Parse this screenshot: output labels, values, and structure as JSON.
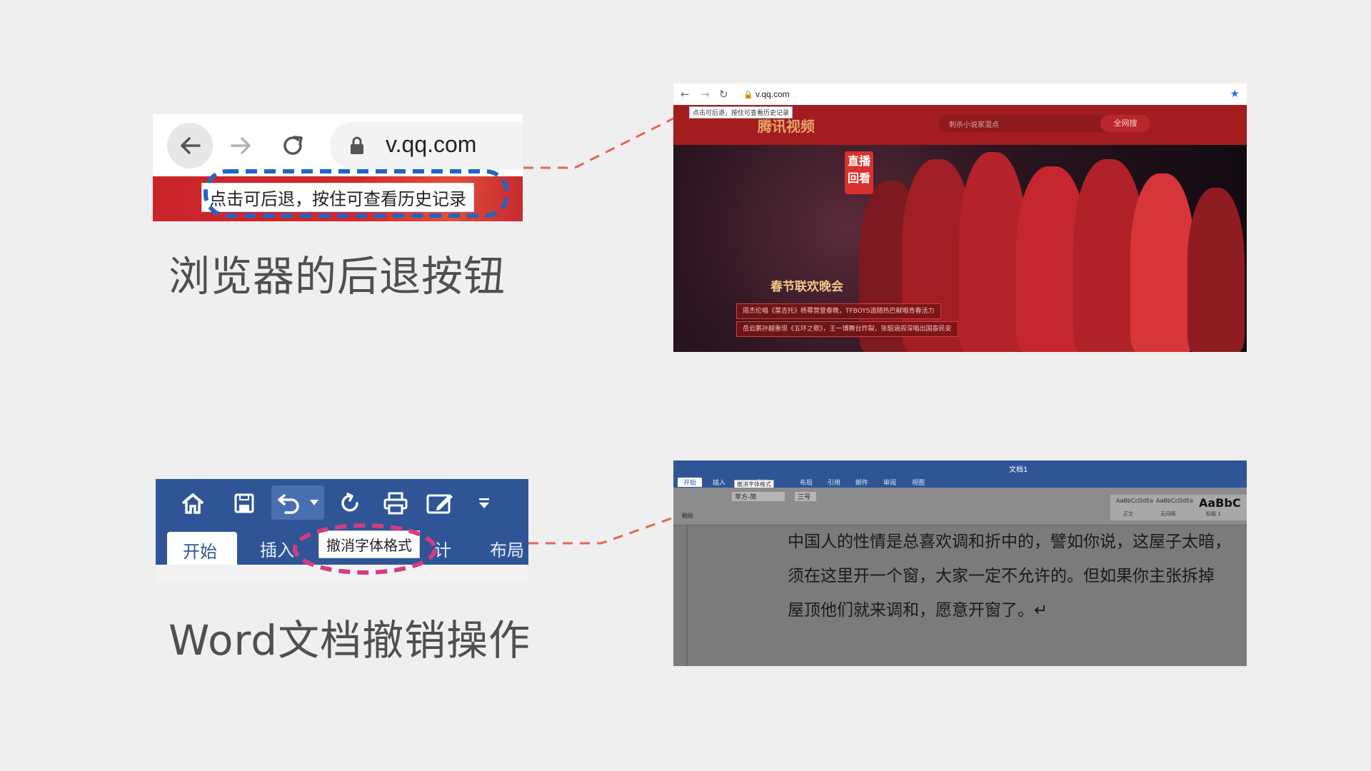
{
  "example_browser": {
    "url": "v.qq.com",
    "tooltip": "点击可后退，按住可查看历史记录",
    "caption": "浏览器的后退按钮"
  },
  "example_word": {
    "tab_home": "开始",
    "tab_insert": "插入",
    "tab_design_partial": "计",
    "tab_layout": "布局",
    "tooltip": "撤消字体格式",
    "caption": "Word文档撤销操作"
  },
  "screenshot_browser": {
    "url": "v.qq.com",
    "tooltip": "点击可后退，按住可查看历史记录",
    "logo": "腾讯视频",
    "search_placeholder": "刺杀小说家混点",
    "search_button": "全网搜",
    "badge": "直播回看",
    "gala_title": "春节联欢晚会",
    "news_1": "周杰伦唱《莫吉托》杨幂营登春晚，TFBOYS追随热巴献唱青春活力",
    "news_2": "岳云鹏孙越重现《五环之歌》，王一博舞台炸裂，张韶涵周深唱出国泰民安"
  },
  "screenshot_word": {
    "title": "文档1",
    "tabs": [
      "开始",
      "插入",
      "设计",
      "布局",
      "引用",
      "邮件",
      "审阅",
      "视图"
    ],
    "tooltip": "撤消字体格式",
    "font_name": "苹方-简",
    "font_size": "三号",
    "paste_label": "粘贴",
    "styles": [
      "AaBbCcDdEe",
      "AaBbCcDdEe",
      "AaBbC"
    ],
    "style_names": [
      "正文",
      "无间隔",
      "标题 1"
    ],
    "doc_lines": [
      "中国人的性情是总喜欢调和折中的，譬如你说，这屋子太暗，",
      "须在这里开一个窗，大家一定不允许的。但如果你主张拆掉",
      "屋顶他们就来调和，愿意开窗了。↵"
    ]
  },
  "colors": {
    "accent_dash_blue": "#1f66c4",
    "accent_dash_pink": "#d63c7f",
    "connector": "#e5674a",
    "word_blue": "#2f5597",
    "tencent_red": "#c8242a"
  }
}
